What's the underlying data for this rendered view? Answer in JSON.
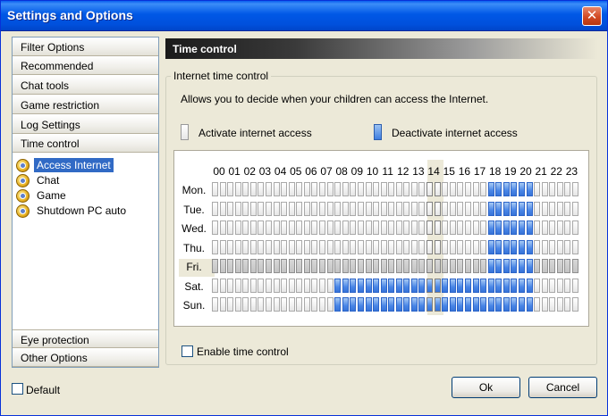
{
  "window": {
    "title": "Settings and Options",
    "close_glyph": "✕"
  },
  "nav": {
    "tabs_top": [
      {
        "label": "Filter Options"
      },
      {
        "label": "Recommended"
      },
      {
        "label": "Chat tools"
      },
      {
        "label": "Game restriction"
      },
      {
        "label": "Log Settings"
      },
      {
        "label": "Time control"
      }
    ],
    "subitems": [
      {
        "label": "Access Internet",
        "icon": "shield-icon",
        "selected": true
      },
      {
        "label": "Chat",
        "icon": "shield-icon",
        "selected": false
      },
      {
        "label": "Game",
        "icon": "shield-icon",
        "selected": false
      },
      {
        "label": "Shutdown PC auto",
        "icon": "shield-icon",
        "selected": false
      }
    ],
    "tabs_bottom": [
      {
        "label": "Eye protection"
      },
      {
        "label": "Other Options"
      }
    ]
  },
  "panel": {
    "header_title": "Time control",
    "group_label": "Internet time control",
    "description": "Allows you to decide when your children can access the Internet.",
    "legend_activate": "Activate internet access",
    "legend_deactivate": "Deactivate internet access",
    "enable_label": "Enable time control",
    "enable_checked": false
  },
  "schedule": {
    "hours": [
      "00",
      "01",
      "02",
      "03",
      "04",
      "05",
      "06",
      "07",
      "08",
      "09",
      "10",
      "11",
      "12",
      "13",
      "14",
      "15",
      "16",
      "17",
      "18",
      "19",
      "20",
      "21",
      "22",
      "23"
    ],
    "days": [
      "Mon.",
      "Tue.",
      "Wed.",
      "Thu.",
      "Fri.",
      "Sat.",
      "Sun."
    ],
    "highlighted_hour": "14",
    "highlighted_day": "Fri.",
    "blocked": {
      "Mon.": [
        "18",
        "19",
        "20"
      ],
      "Tue.": [
        "18",
        "19",
        "20"
      ],
      "Wed.": [
        "18",
        "19",
        "20"
      ],
      "Thu.": [
        "18",
        "19",
        "20"
      ],
      "Fri.": [
        "18",
        "19",
        "20"
      ],
      "Sat.": [
        "08",
        "09",
        "10",
        "11",
        "12",
        "13",
        "14",
        "15",
        "16",
        "17",
        "18",
        "19",
        "20"
      ],
      "Sun.": [
        "08",
        "09",
        "10",
        "11",
        "12",
        "13",
        "14",
        "15",
        "16",
        "17",
        "18",
        "19",
        "20"
      ]
    },
    "colors": {
      "blocked": "#4A86E6",
      "open": "#FFFFFF"
    }
  },
  "footer": {
    "default_label": "Default",
    "default_checked": false,
    "ok_label": "Ok",
    "cancel_label": "Cancel"
  }
}
